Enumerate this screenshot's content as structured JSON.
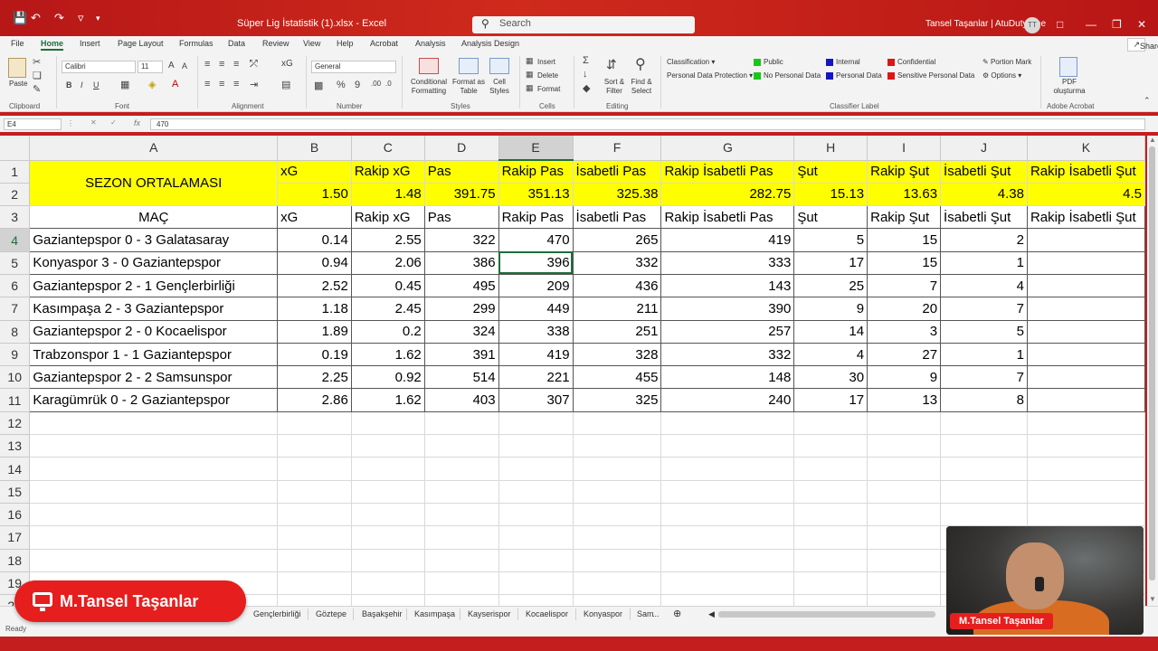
{
  "window": {
    "title": "Süper Lig İstatistik (1).xlsx  -  Excel",
    "search_placeholder": "Search",
    "user": "Tansel Taşanlar | AtuDutyFree",
    "avatar_initials": "TT"
  },
  "ribbon_tabs": [
    "File",
    "Home",
    "Insert",
    "Page Layout",
    "Formulas",
    "Data",
    "Review",
    "View",
    "Help",
    "Acrobat",
    "Analysis",
    "Analysis Design"
  ],
  "share_label": "Share",
  "ribbon": {
    "paste": "Paste",
    "clipboard": "Clipboard",
    "font_name": "Calibri",
    "font_size": "11",
    "font": "Font",
    "alignment": "Alignment",
    "number_format": "General",
    "number": "Number",
    "conditional_formatting": "Conditional Formatting",
    "format_as_table": "Format as Table",
    "cell_styles": "Cell Styles",
    "styles": "Styles",
    "insert": "Insert",
    "delete": "Delete",
    "format": "Format",
    "cells": "Cells",
    "sort_filter": "Sort & Filter",
    "find_select": "Find & Select",
    "editing": "Editing",
    "classification": "Classification",
    "personal_data_protection": "Personal Data Protection",
    "public": "Public",
    "no_personal_data": "No Personal Data",
    "internal": "Internal",
    "personal_data": "Personal Data",
    "confidential": "Confidential",
    "sensitive_personal_data": "Sensitive Personal Data",
    "portion_mark": "Portion Mark",
    "options": "Options",
    "classifier_label": "Classifier Label",
    "pdf": "PDF oluşturma",
    "adobe_acrobat": "Adobe Acrobat"
  },
  "formula_bar": {
    "name_box": "E4",
    "fx": "fx",
    "value": "470"
  },
  "columns": [
    "A",
    "B",
    "C",
    "D",
    "E",
    "F",
    "G",
    "H",
    "I",
    "J",
    "K"
  ],
  "rows": [
    [
      "SEZON ORTALAMASI",
      "xG",
      "Rakip xG",
      "Pas",
      "Rakip Pas",
      "İsabetli Pas",
      "Rakip İsabetli Pas",
      "Şut",
      "Rakip Şut",
      "İsabetli Şut",
      "Rakip İsabetli Şut"
    ],
    [
      "",
      "1.50",
      "1.48",
      "391.75",
      "351.13",
      "325.38",
      "282.75",
      "15.13",
      "13.63",
      "4.38",
      "4.5"
    ],
    [
      "MAÇ",
      "xG",
      "Rakip xG",
      "Pas",
      "Rakip Pas",
      "İsabetli Pas",
      "Rakip İsabetli Pas",
      "Şut",
      "Rakip Şut",
      "İsabetli Şut",
      "Rakip İsabetli Şut"
    ],
    [
      "Gaziantepspor 0 - 3 Galatasaray",
      "0.14",
      "2.55",
      "322",
      "470",
      "265",
      "419",
      "5",
      "15",
      "2",
      ""
    ],
    [
      "Konyaspor 3 - 0 Gaziantepspor",
      "0.94",
      "2.06",
      "386",
      "396",
      "332",
      "333",
      "17",
      "15",
      "1",
      ""
    ],
    [
      "Gaziantepspor 2 - 1 Gençlerbirliği",
      "2.52",
      "0.45",
      "495",
      "209",
      "436",
      "143",
      "25",
      "7",
      "4",
      ""
    ],
    [
      "Kasımpaşa 2 - 3 Gaziantepspor",
      "1.18",
      "2.45",
      "299",
      "449",
      "211",
      "390",
      "9",
      "20",
      "7",
      ""
    ],
    [
      "Gaziantepspor 2 - 0 Kocaelispor",
      "1.89",
      "0.2",
      "324",
      "338",
      "251",
      "257",
      "14",
      "3",
      "5",
      ""
    ],
    [
      "Trabzonspor 1 - 1 Gaziantepspor",
      "0.19",
      "1.62",
      "391",
      "419",
      "328",
      "332",
      "4",
      "27",
      "1",
      ""
    ],
    [
      "Gaziantepspor 2 - 2 Samsunspor",
      "2.25",
      "0.92",
      "514",
      "221",
      "455",
      "148",
      "30",
      "9",
      "7",
      ""
    ],
    [
      "Karagümrük 0 - 2 Gaziantepspor",
      "2.86",
      "1.62",
      "403",
      "307",
      "325",
      "240",
      "17",
      "13",
      "8",
      ""
    ]
  ],
  "empty_rows": [
    "12",
    "13",
    "14",
    "15",
    "16",
    "17",
    "18",
    "19",
    "20"
  ],
  "sheet_tabs": [
    "Gençlerbirliği",
    "Göztepe",
    "Başakşehir",
    "Kasımpaşa",
    "Kayserispor",
    "Kocaelispor",
    "Konyaspor",
    "Sam"
  ],
  "more_tabs": "...",
  "status": "Ready",
  "badge": "M.Tansel Taşanlar",
  "webcam_label": "M.Tansel Taşanlar",
  "colors": {
    "accent": "#1e6e3a",
    "highlight": "#ffff00",
    "brand_red": "#e61e1e"
  }
}
